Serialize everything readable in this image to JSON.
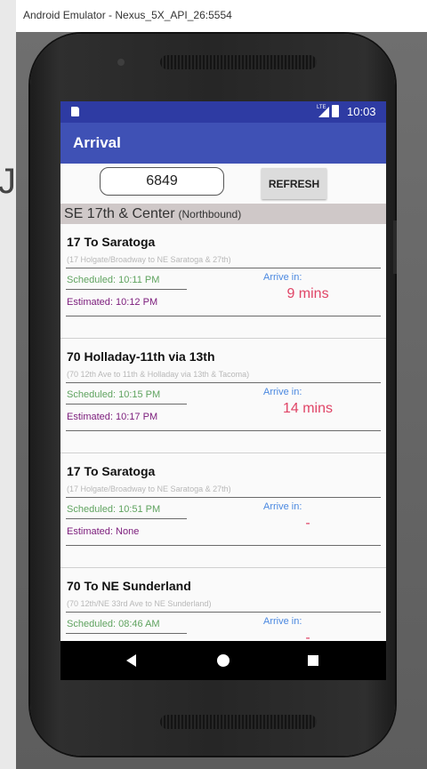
{
  "window": {
    "title": "Android Emulator - Nexus_5X_API_26:5554"
  },
  "background": {
    "partial_glyph": "J"
  },
  "statusbar": {
    "time": "10:03",
    "network": "LTE",
    "icons": [
      "sd-card-icon",
      "signal-icon",
      "battery-icon"
    ]
  },
  "appbar": {
    "title": "Arrival"
  },
  "search": {
    "stop_id": "6849",
    "refresh_label": "REFRESH"
  },
  "stop": {
    "name": "SE 17th & Center",
    "direction": "(Northbound)"
  },
  "arrivals": [
    {
      "route": "17 To Saratoga",
      "description": "(17  Holgate/Broadway to NE Saratoga & 27th)",
      "scheduled": "Scheduled: 10:11 PM",
      "estimated": "Estimated: 10:12 PM",
      "arrive_label": "Arrive in:",
      "arrive_value": "9 mins"
    },
    {
      "route": "70 Holladay-11th via 13th",
      "description": "(70  12th Ave to 11th & Holladay via 13th & Tacoma)",
      "scheduled": "Scheduled: 10:15 PM",
      "estimated": "Estimated: 10:17 PM",
      "arrive_label": "Arrive in:",
      "arrive_value": "14 mins"
    },
    {
      "route": "17 To Saratoga",
      "description": "(17  Holgate/Broadway to NE Saratoga & 27th)",
      "scheduled": "Scheduled: 10:51 PM",
      "estimated": "Estimated: None",
      "arrive_label": "Arrive in:",
      "arrive_value": "-"
    },
    {
      "route": "70 To NE Sunderland",
      "description": "(70  12th/NE 33rd Ave to NE Sunderland)",
      "scheduled": "Scheduled: 08:46 AM",
      "estimated": "",
      "arrive_label": "Arrive in:",
      "arrive_value": "-"
    }
  ],
  "navbar": {
    "icons": [
      "back-icon",
      "home-icon",
      "recents-icon"
    ]
  },
  "colors": {
    "statusbar": "#2e3ba3",
    "appbar": "#3f51b5",
    "scheduled": "#5fa35f",
    "estimated": "#7b1b7b",
    "arrive_label": "#4a88e0",
    "arrive_value": "#e04466",
    "stop_header": "#cfc8c8"
  }
}
